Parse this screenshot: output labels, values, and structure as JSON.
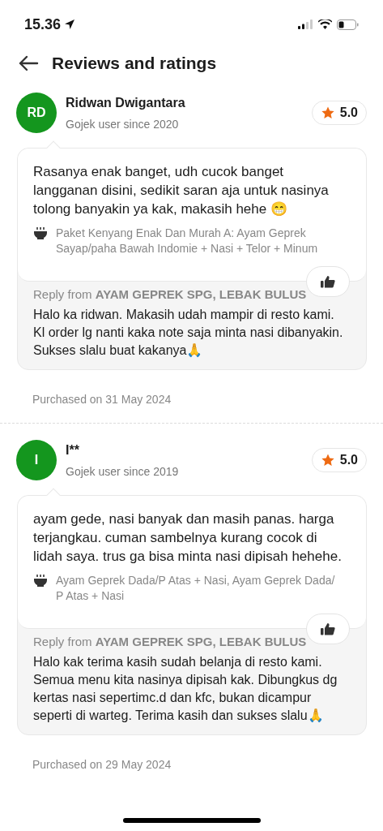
{
  "status_bar": {
    "time": "15.36"
  },
  "header": {
    "title": "Reviews and ratings"
  },
  "reviews": [
    {
      "initials": "RD",
      "name": "Ridwan Dwigantara",
      "member_since": "Gojek user since 2020",
      "rating": "5.0",
      "text": "Rasanya enak banget, udh cucok banget langganan disini, sedikit saran aja untuk nasinya tolong banyakin ya kak, makasih hehe 😁",
      "items": "Paket Kenyang Enak Dan Murah A: Ayam Geprek Sayap/paha Bawah Indomie + Nasi + Telor + Minum",
      "reply_label": "Reply from **AYAM GEPREK SPG, LEBAK BULUS**",
      "reply": "Halo ka ridwan. Makasih udah mampir di resto kami. Kl order lg nanti kaka note saja minta nasi dibanyakin. Sukses slalu buat kakanya🙏",
      "purchased": "Purchased on 31 May 2024"
    },
    {
      "initials": "I",
      "name": "I**",
      "member_since": "Gojek user since 2019",
      "rating": "5.0",
      "text": "ayam gede, nasi banyak dan masih panas. harga terjangkau. cuman sambelnya kurang cocok di lidah saya. trus ga bisa minta nasi dipisah hehehe.",
      "items": "Ayam Geprek Dada/P Atas + Nasi, Ayam Geprek Dada/ P Atas + Nasi",
      "reply_label": "Reply from **AYAM GEPREK SPG, LEBAK BULUS**",
      "reply": "Halo kak terima kasih sudah belanja di resto kami. Semua menu kita nasinya dipisah kak. Dibungkus dg kertas nasi sepertimc.d dan kfc, bukan dicampur seperti di warteg. Terima kasih dan sukses slalu🙏",
      "purchased": "Purchased on 29 May 2024"
    }
  ]
}
